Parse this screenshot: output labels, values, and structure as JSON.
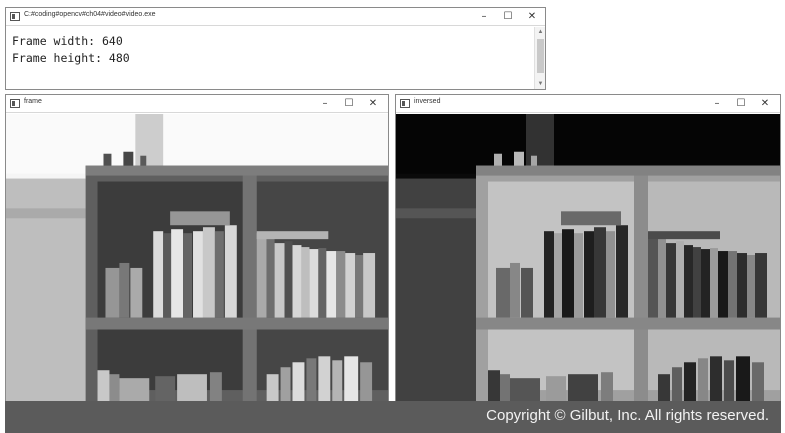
{
  "console": {
    "title": "C:#coding#opencv#ch04#video#video.exe",
    "lines": [
      "Frame width: 640",
      "Frame height: 480"
    ],
    "controls": {
      "minimize": "–",
      "maximize": "☐",
      "close": "✕"
    }
  },
  "frame_window": {
    "title": "frame",
    "controls": {
      "minimize": "–",
      "maximize": "☐",
      "close": "✕"
    }
  },
  "inversed_window": {
    "title": "inversed",
    "controls": {
      "minimize": "–",
      "maximize": "☐",
      "close": "✕"
    }
  },
  "footer": {
    "text": "Copyright © Gilbut, Inc. All rights reserved."
  },
  "scroll_icons": {
    "up": "▲",
    "down": "▼"
  }
}
